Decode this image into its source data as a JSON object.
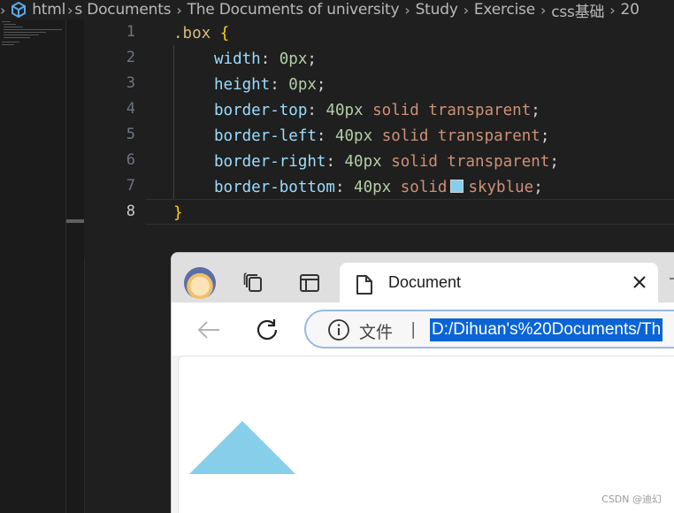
{
  "breadcrumb": {
    "items": [
      "html",
      "s Documents",
      "The Documents of university",
      "Study",
      "Exercise",
      "css基础",
      "20"
    ]
  },
  "editor": {
    "line_numbers": [
      "1",
      "2",
      "3",
      "4",
      "5",
      "6",
      "7",
      "8"
    ],
    "active_line": "8",
    "code": {
      "selector": ".box",
      "open_brace": "{",
      "close_brace": "}",
      "declarations": [
        {
          "property": "width",
          "number": "0px",
          "keywords": ""
        },
        {
          "property": "height",
          "number": "0px",
          "keywords": ""
        },
        {
          "property": "border-top",
          "number": "40px",
          "keywords": "solid transparent"
        },
        {
          "property": "border-left",
          "number": "40px",
          "keywords": "solid transparent"
        },
        {
          "property": "border-right",
          "number": "40px",
          "keywords": "solid transparent"
        },
        {
          "property": "border-bottom",
          "number": "40px",
          "keywords": "solid",
          "color_name": "skyblue"
        }
      ]
    },
    "swatch_color": "#87ceeb"
  },
  "browser": {
    "tab_title": "Document",
    "address": {
      "scheme_label": "文件",
      "divider": "|",
      "url": "D:/Dihuan's%20Documents/Th"
    },
    "page": {
      "triangle_color": "#87ceeb"
    }
  },
  "watermark": "CSDN @迪幻",
  "colors": {
    "editor_bg": "#1f1f1f",
    "selector": "#d7ba7d",
    "property": "#9cdcfe",
    "number": "#b5cea8",
    "keyword": "#ce9178",
    "url_highlight": "#0a64d6"
  },
  "icons": {
    "breadcrumb": [
      "chevron-right-icon",
      "css-file-icon"
    ],
    "browser_toolbar": [
      "profile-avatar",
      "collections-icon",
      "tab-actions-icon",
      "document-icon",
      "close-icon",
      "new-tab-icon",
      "back-arrow-icon",
      "refresh-icon",
      "info-icon"
    ]
  }
}
